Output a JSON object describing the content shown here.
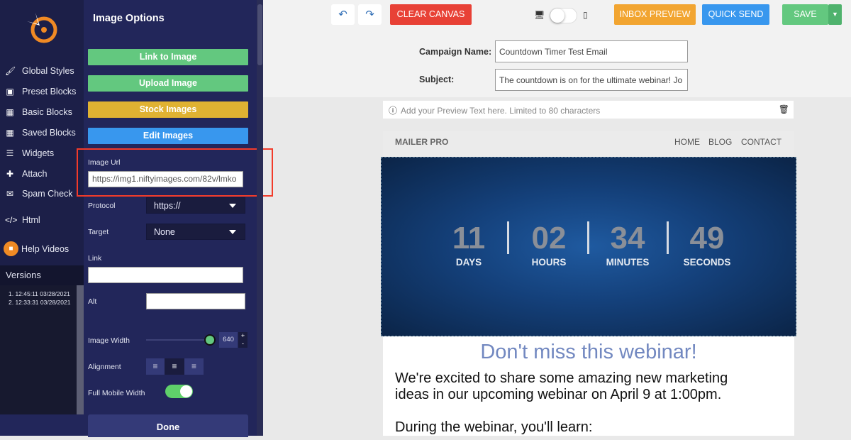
{
  "nav": {
    "items": [
      {
        "label": "Global Styles",
        "icon": "brush-icon"
      },
      {
        "label": "Preset Blocks",
        "icon": "gift-icon"
      },
      {
        "label": "Basic Blocks",
        "icon": "grid-icon"
      },
      {
        "label": "Saved Blocks",
        "icon": "grid-icon"
      },
      {
        "label": "Widgets",
        "icon": "list-icon"
      },
      {
        "label": "Attach",
        "icon": "plus-icon"
      },
      {
        "label": "Spam Check",
        "icon": "envelope-icon"
      },
      {
        "label": "Html",
        "icon": "code-icon"
      },
      {
        "label": "Help Videos",
        "icon": "video-icon"
      }
    ],
    "versions_title": "Versions",
    "versions": [
      "1. 12:45:11 03/28/2021",
      "2. 12:33:31 03/28/2021"
    ]
  },
  "panel": {
    "title": "Image Options",
    "link_to_image": "Link to Image",
    "upload_image": "Upload Image",
    "stock_images": "Stock Images",
    "edit_images": "Edit Images",
    "image_url_label": "Image Url",
    "image_url": "https://img1.niftyimages.com/82v/lmko",
    "protocol_label": "Protocol",
    "protocol": "https://",
    "target_label": "Target",
    "target": "None",
    "link_label": "Link",
    "link": "",
    "alt_label": "Alt",
    "alt": "",
    "image_width_label": "Image Width",
    "image_width": "640",
    "plus": "+",
    "minus": "-",
    "alignment_label": "Alignment",
    "alignment": "center",
    "full_mobile_label": "Full Mobile Width",
    "full_mobile": true,
    "done": "Done"
  },
  "toolbar": {
    "clear": "CLEAR CANVAS",
    "inbox": "INBOX PREVIEW",
    "quick": "QUICK SEND",
    "save": "SAVE",
    "view": "desktop"
  },
  "form": {
    "campaign_label": "Campaign Name:",
    "campaign": "Countdown Timer Test Email",
    "subject_label": "Subject:",
    "subject": "The countdown is on for the ultimate webinar! Jo"
  },
  "preview_text": "Add your Preview Text here. Limited to 80 characters",
  "email": {
    "brand": "MAILER PRO",
    "links": [
      "HOME",
      "BLOG",
      "CONTACT"
    ],
    "countdown": [
      {
        "n": "11",
        "u": "DAYS"
      },
      {
        "n": "02",
        "u": "HOURS"
      },
      {
        "n": "34",
        "u": "MINUTES"
      },
      {
        "n": "49",
        "u": "SECONDS"
      }
    ],
    "heading": "Don't miss this webinar!",
    "body1": "We're excited to share some amazing new marketing ideas in our upcoming webinar on April 9 at 1:00pm.",
    "body2": "During the webinar, you'll learn:"
  },
  "colors": {
    "green": "#63c87f",
    "yellow": "#e0b232",
    "blue": "#3897ee",
    "red": "#e84136",
    "orange": "#f2a531",
    "highlight": "#f23b2a"
  }
}
